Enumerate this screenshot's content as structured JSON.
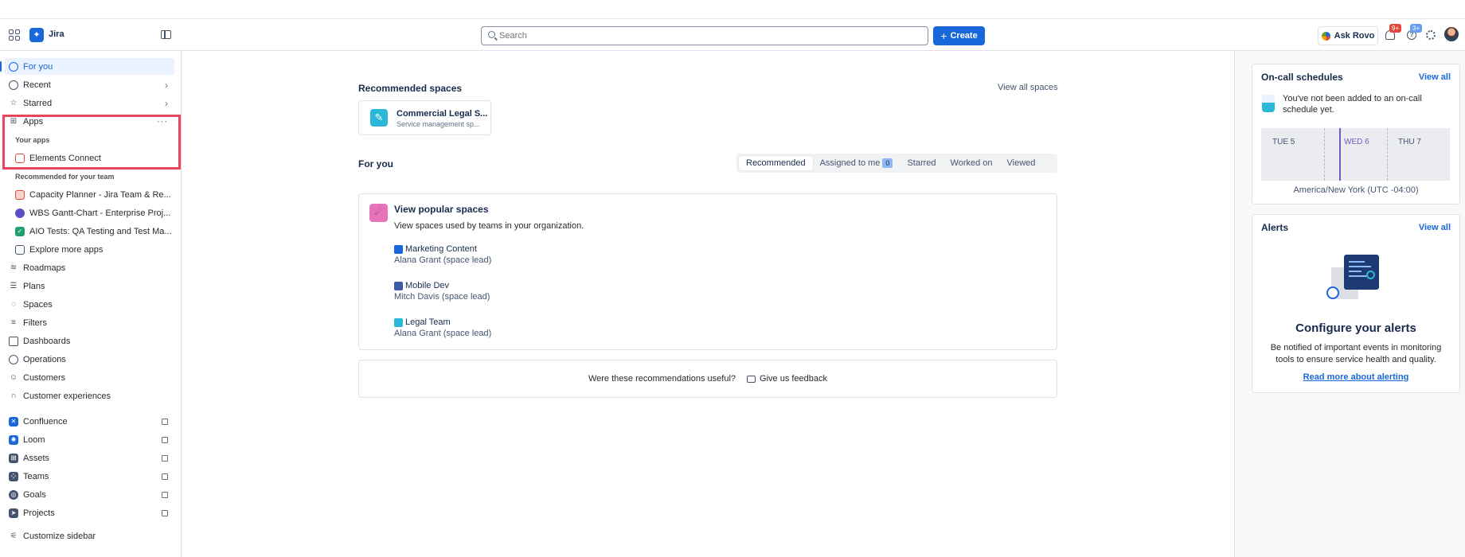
{
  "topbar": {
    "product": "Jira",
    "search_placeholder": "Search",
    "create_label": "Create",
    "ask_rovo_label": "Ask Rovo",
    "notifications_badge": "9+",
    "help_badge": "3+",
    "help_glyph": "?"
  },
  "sidebar": {
    "for_you": "For you",
    "recent": "Recent",
    "starred": "Starred",
    "apps": "Apps",
    "apps_more": "···",
    "your_apps_label": "Your apps",
    "elements_connect": "Elements Connect",
    "recommended_label": "Recommended for your team",
    "recommended_apps": [
      "Capacity Planner - Jira Team & Re...",
      "WBS Gantt-Chart - Enterprise Proj...",
      "AIO Tests: QA Testing and Test Ma..."
    ],
    "explore_more_apps": "Explore more apps",
    "roadmaps": "Roadmaps",
    "plans": "Plans",
    "spaces": "Spaces",
    "filters": "Filters",
    "dashboards": "Dashboards",
    "operations": "Operations",
    "customers": "Customers",
    "customer_experiences": "Customer experiences",
    "confluence": "Confluence",
    "loom": "Loom",
    "assets": "Assets",
    "teams": "Teams",
    "goals": "Goals",
    "projects": "Projects",
    "customize_sidebar": "Customize sidebar"
  },
  "main": {
    "recommended_spaces_title": "Recommended spaces",
    "view_all_spaces": "View all spaces",
    "space_card": {
      "name": "Commercial Legal S...",
      "type": "Service management sp..."
    },
    "for_you_title": "For you",
    "tabs": [
      {
        "label": "Recommended"
      },
      {
        "label": "Assigned to me",
        "count": "0"
      },
      {
        "label": "Starred"
      },
      {
        "label": "Worked on"
      },
      {
        "label": "Viewed"
      }
    ],
    "popular": {
      "title": "View popular spaces",
      "description": "View spaces used by teams in your organization.",
      "spaces": [
        {
          "name": "Marketing Content",
          "lead": "Alana Grant (space lead)"
        },
        {
          "name": "Mobile Dev",
          "lead": "Mitch Davis (space lead)"
        },
        {
          "name": "Legal Team",
          "lead": "Alana Grant (space lead)"
        }
      ]
    },
    "feedback_question": "Were these recommendations useful?",
    "feedback_button": "Give us feedback"
  },
  "right_panel": {
    "oncall": {
      "title": "On-call schedules",
      "view_all": "View all",
      "message": "You've not been added to an on-call schedule yet.",
      "days": [
        "TUE 5",
        "WED 6",
        "THU 7"
      ],
      "timezone": "America/New York (UTC -04:00)"
    },
    "alerts": {
      "title": "Alerts",
      "view_all": "View all",
      "heading": "Configure your alerts",
      "description": "Be notified of important events in monitoring tools to ensure service health and quality.",
      "link": "Read more about alerting"
    }
  },
  "colors": {
    "brand": "#1868db",
    "highlight": "#e8465b",
    "current_day": "#6e5dc6"
  }
}
